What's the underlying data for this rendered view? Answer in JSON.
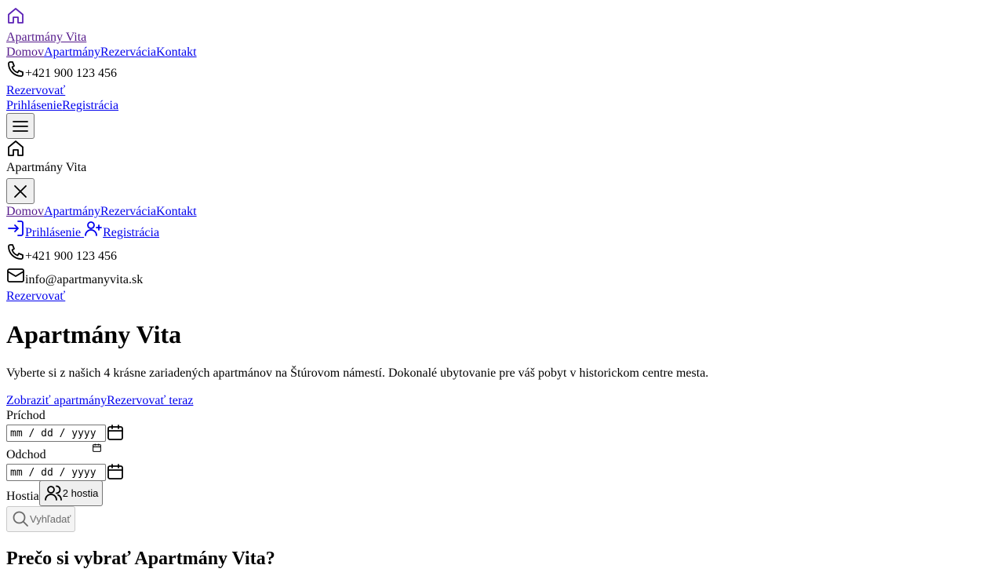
{
  "brand": {
    "name": "Apartmány Vita",
    "logo_icon": "home-icon"
  },
  "nav": {
    "items": [
      {
        "label": "Domov"
      },
      {
        "label": "Apartmány"
      },
      {
        "label": "Rezervácia"
      },
      {
        "label": "Kontakt"
      }
    ]
  },
  "contact": {
    "phone": "+421 900 123 456",
    "email": "info@apartmanyvita.sk"
  },
  "header": {
    "book_label": "Rezervovať",
    "login_label": "Prihlásenie",
    "register_label": "Registrácia"
  },
  "mobile_menu": {
    "title": "Apartmány Vita",
    "book_label": "Rezervovať"
  },
  "hero": {
    "title": "Apartmány Vita",
    "description": "Vyberte si z našich 4 krásne zariadených apartmánov na Štúrovom námestí. Dokonalé ubytovanie pre váš pobyt v historickom centre mesta.",
    "cta_primary": "Zobraziť apartmány",
    "cta_secondary": "Rezervovať teraz"
  },
  "search": {
    "checkin_label": "Príchod",
    "checkout_label": "Odchod",
    "date_placeholder": "mm / dd / yyyy",
    "guests_label": "Hostia",
    "guests_value": "2 hostia",
    "submit_label": "Vyhľadať"
  },
  "features": {
    "title": "Prečo si vybrať Apartmány Vita?"
  }
}
